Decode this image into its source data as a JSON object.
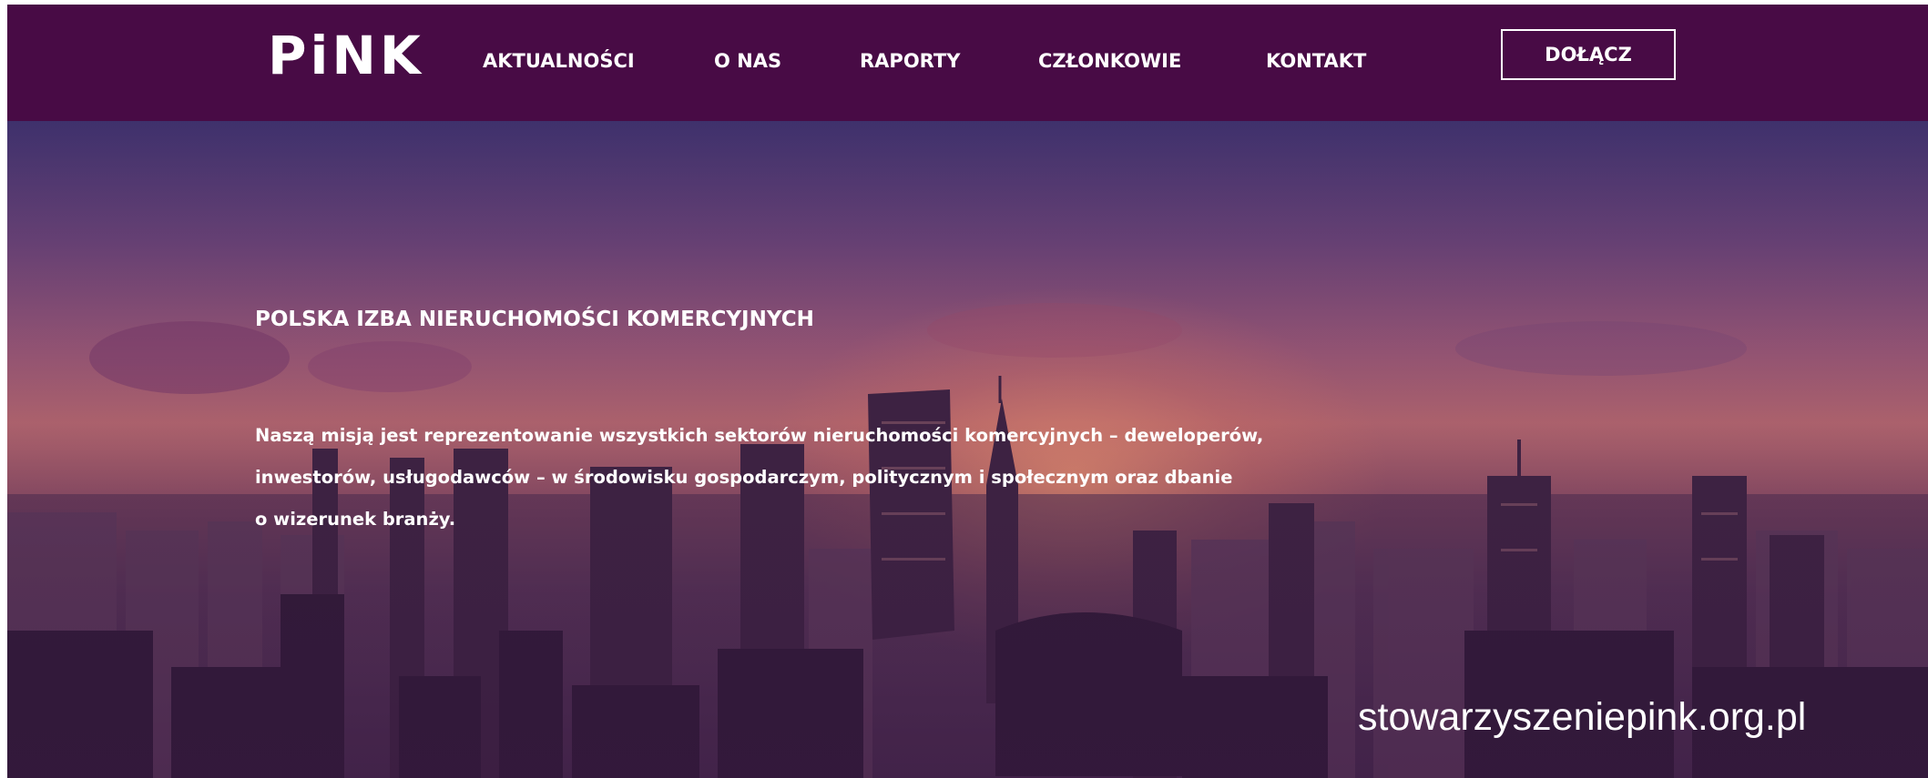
{
  "navbar": {
    "logo_text": "PiNK",
    "items": [
      {
        "label": "AKTUALNOŚCI"
      },
      {
        "label": "O NAS"
      },
      {
        "label": "RAPORTY"
      },
      {
        "label": "CZŁONKOWIE"
      },
      {
        "label": "KONTAKT"
      }
    ],
    "join_label": "DOŁĄCZ",
    "background_color": "#480b45"
  },
  "hero": {
    "title": "POLSKA IZBA NIERUCHOMOŚCI KOMERCYJNYCH",
    "mission_lines": [
      "Naszą misją jest reprezentowanie wszystkich sektorów nieruchomości komercyjnych – deweloperów,",
      "inwestorów, usługodawców  – w środowisku gospodarczym, politycznym i społecznym oraz dbanie",
      "o wizerunek branży."
    ],
    "background_image": "city-skyline-at-sunset"
  },
  "watermark": {
    "url": "stowarzyszeniepink.org.pl"
  }
}
